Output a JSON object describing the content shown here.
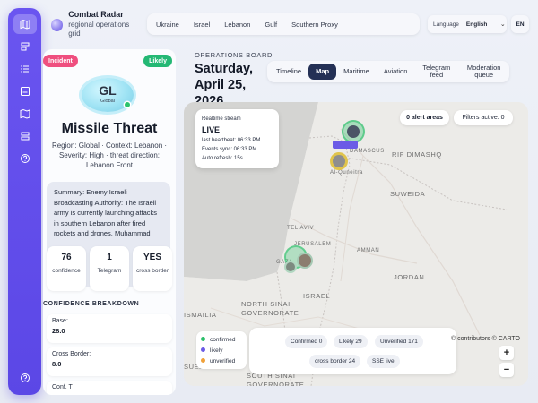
{
  "brand": {
    "title": "Combat Radar",
    "subtitle": "regional operations grid"
  },
  "regions": [
    "Ukraine",
    "Israel",
    "Lebanon",
    "Gulf",
    "Southern Proxy"
  ],
  "language": {
    "label": "Language",
    "selected": "English",
    "code": "EN"
  },
  "rail": {
    "items": [
      "map-icon",
      "layers-icon",
      "list-icon",
      "feed-icon",
      "map-outline-icon",
      "stack-icon",
      "help-icon"
    ],
    "bottom": "help-icon"
  },
  "incident": {
    "badge": "Incident",
    "status": "Likely",
    "code": "GL",
    "code_sub": "Global",
    "title": "Missile Threat",
    "meta": "Region: Global · Context: Lebanon · Severity: High · threat direction: Lebanon Front",
    "summary_label": "Summary:",
    "summary": "Enemy Israeli Broadcasting Authority: The Israeli army is currently launching attacks in southern Lebanon after fired rockets and drones. Muhammad",
    "stats": [
      {
        "value": "76",
        "label": "confidence"
      },
      {
        "value": "1",
        "label": "Telegram"
      },
      {
        "value": "YES",
        "label": "cross border"
      }
    ],
    "breakdown_title": "CONFIDENCE BREAKDOWN",
    "breakdown": [
      {
        "label": "Base:",
        "value": "28.0"
      },
      {
        "label": "Cross Border:",
        "value": "8.0"
      },
      {
        "label": "Conf. T",
        "value": ""
      }
    ]
  },
  "board": {
    "label": "OPERATIONS BOARD",
    "date": "Saturday, April 25, 2026",
    "tabs": [
      "Timeline",
      "Map",
      "Maritime",
      "Aviation",
      "Telegram feed",
      "Moderation queue"
    ],
    "active_tab": "Map"
  },
  "map": {
    "stream": {
      "title": "Realtime stream",
      "status": "LIVE",
      "heartbeat": "last heartbeat: 06:33 PM",
      "sync": "Events sync: 06:33 PM",
      "refresh": "Auto refresh: 15s"
    },
    "alerts": "0 alert areas",
    "filters": "Filters active: 0",
    "labels": [
      "RIF DIMASHQ",
      "SUWEIDA",
      "DAMASCUS",
      "Al-Quneitra",
      "TEL AVIV",
      "JERUSALEM",
      "GAZA",
      "JORDAN",
      "ISRAEL",
      "NORTH SINAI GOVERNORATE",
      "SOUTH SINAI GOVERNORATE",
      "ISMAILIA",
      "SUEZ",
      "AMMAN"
    ],
    "legend": [
      {
        "label": "confirmed",
        "color": "#2bbf6a"
      },
      {
        "label": "likely",
        "color": "#6b5be6"
      },
      {
        "label": "unverified",
        "color": "#f0a13a"
      }
    ],
    "counts": [
      "Confirmed 0",
      "Likely 29",
      "Unverified 171",
      "cross border 24",
      "SSE live"
    ],
    "attribution": "© contributors © CARTO",
    "zoom_in": "+",
    "zoom_out": "−"
  }
}
